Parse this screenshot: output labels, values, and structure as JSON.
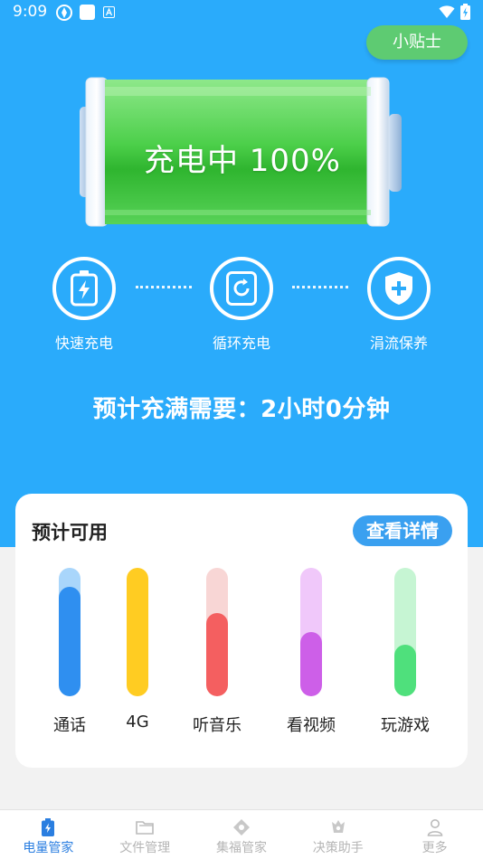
{
  "status_bar": {
    "time": "9:09"
  },
  "header": {
    "tips_label": "小贴士"
  },
  "battery": {
    "status_text": "充电中 100%",
    "level_percent": 100
  },
  "modes": [
    {
      "label": "快速充电",
      "icon": "fast-charge-icon"
    },
    {
      "label": "循环充电",
      "icon": "cycle-charge-icon"
    },
    {
      "label": "涓流保养",
      "icon": "trickle-shield-icon"
    }
  ],
  "estimate_text": "预计充满需要：2小时0分钟",
  "usage_card": {
    "title": "预计可用",
    "detail_label": "查看详情",
    "items": [
      {
        "label": "通话",
        "fill_fraction": 0.85,
        "fill_color": "#2f8ff0",
        "track_color": "#a9d6fb"
      },
      {
        "label": "4G",
        "fill_fraction": 1.0,
        "fill_color": "#ffcc22",
        "track_color": "#ffe89a"
      },
      {
        "label": "听音乐",
        "fill_fraction": 0.65,
        "fill_color": "#f45f60",
        "track_color": "#f8d6d5"
      },
      {
        "label": "看视频",
        "fill_fraction": 0.5,
        "fill_color": "#cd5fe8",
        "track_color": "#f0c8fa"
      },
      {
        "label": "玩游戏",
        "fill_fraction": 0.4,
        "fill_color": "#4fe07c",
        "track_color": "#c6f5d3"
      }
    ]
  },
  "bottom_nav": [
    {
      "label": "电量管家",
      "icon": "battery-icon",
      "active": true
    },
    {
      "label": "文件管理",
      "icon": "folder-icon",
      "active": false
    },
    {
      "label": "集福管家",
      "icon": "fortune-icon",
      "active": false
    },
    {
      "label": "决策助手",
      "icon": "decision-icon",
      "active": false
    },
    {
      "label": "更多",
      "icon": "person-icon",
      "active": false
    }
  ],
  "colors": {
    "primary_blue": "#2aabfb",
    "tips_green": "#5ecb72",
    "nav_active": "#2a7ee0"
  }
}
